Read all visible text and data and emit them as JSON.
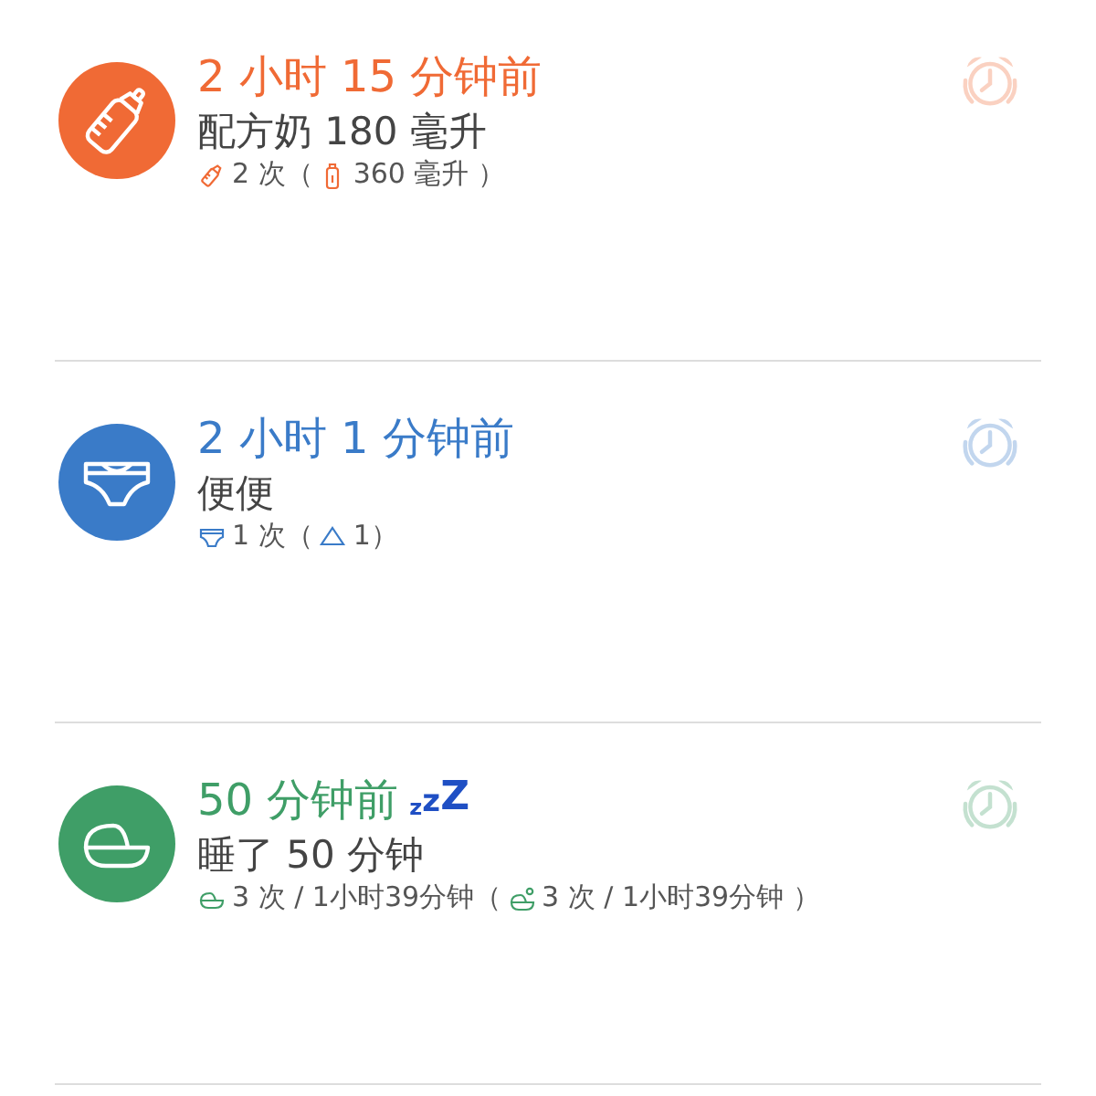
{
  "entries": [
    {
      "kind": "feed",
      "color": "#f06a35",
      "time": "2 小时 15 分钟前",
      "detail": "配方奶 180 毫升",
      "count": "2 次（",
      "total": "360 毫升 ）"
    },
    {
      "kind": "diaper",
      "color": "#3a7bc8",
      "time": "2 小时 1 分钟前",
      "detail": "便便",
      "count": "1 次（",
      "total": "1）"
    },
    {
      "kind": "sleep",
      "color": "#3f9e67",
      "time": "50 分钟前",
      "sleep_mark": "zzZ",
      "detail": "睡了 50 分钟",
      "count": "3 次 / 1小时39分钟（",
      "total": "3 次 / 1小时39分钟 ）"
    }
  ]
}
